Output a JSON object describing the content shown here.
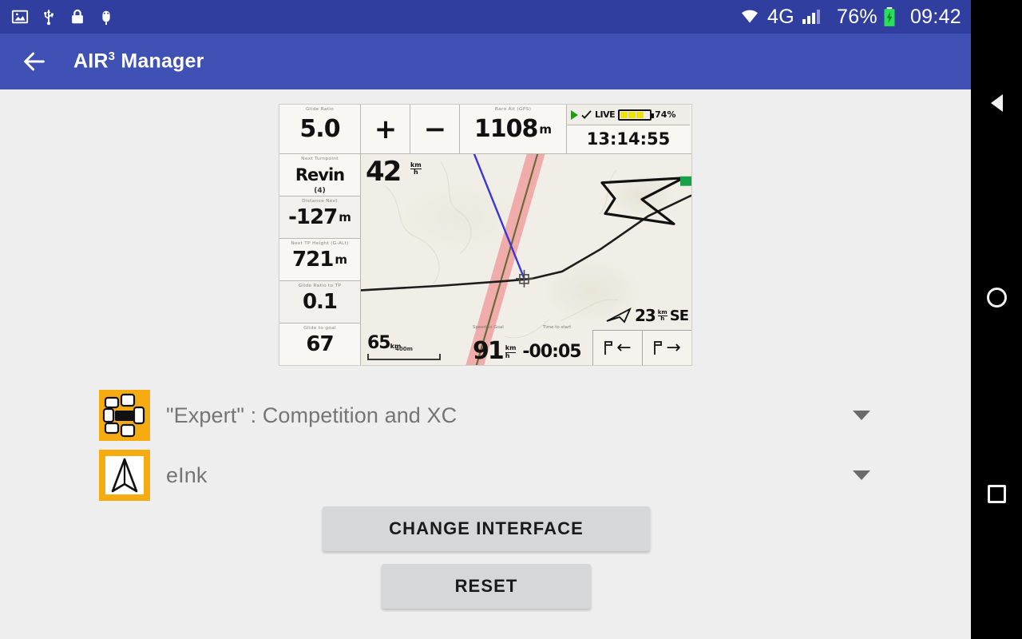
{
  "statusbar": {
    "left_icons": [
      "image-icon",
      "usb-icon",
      "lock-icon",
      "android-debug-icon"
    ],
    "network": "4G",
    "battery_percent": "76%",
    "time": "09:42",
    "bg_color": "#303f9f"
  },
  "appbar": {
    "back_label": "back-arrow",
    "title": "AIR",
    "title_sup": "3",
    "title_rest": " Manager",
    "bg_color": "#3f51b5"
  },
  "device_preview": {
    "top": {
      "glide_ratio": {
        "label": "Glide Ratio",
        "value": "5.0"
      },
      "plus": "+",
      "minus": "−",
      "altitude": {
        "label": "Baro Alt (GPS)",
        "value": "1108",
        "unit": "m"
      },
      "status": {
        "live": "LIVE",
        "battery_percent": "74%",
        "clock": "13:14:55"
      }
    },
    "left_column": [
      {
        "label": "Next Turnpoint",
        "value": "Revin",
        "sub": "(4)"
      },
      {
        "label": "Distance Next",
        "value": "-127",
        "unit": "m"
      },
      {
        "label": "Next TP Height (G-ALt)",
        "value": "721",
        "unit": "m"
      },
      {
        "label": "Glide Ratio to TP",
        "value": "0.1"
      },
      {
        "label": "Glide to goal",
        "value": "67"
      }
    ],
    "map": {
      "speed": "42",
      "speed_unit_top": "km",
      "speed_unit_bottom": "h",
      "scale_value": "65",
      "scale_unit": "km",
      "scale_bar_label": "400m",
      "ground_speed_label": "Speed to Goal",
      "ground_speed": "91",
      "ground_speed_unit_top": "km",
      "ground_speed_unit_bottom": "h",
      "time_label": "Time to start",
      "time_value": "-00:05",
      "wind_speed": "23",
      "wind_unit_top": "km",
      "wind_unit_bottom": "h",
      "wind_direction": "SE",
      "btn_prev": "←",
      "btn_next": "→"
    }
  },
  "selectors": [
    {
      "icon": "interface-layout-icon",
      "label": "\"Expert\" : Competition and XC",
      "caret": "chevron-down-icon"
    },
    {
      "icon": "elnk-navigation-icon",
      "label": "eInk",
      "caret": "chevron-down-icon"
    }
  ],
  "buttons": {
    "change_interface": "CHANGE INTERFACE",
    "reset": "RESET"
  },
  "navbar": {
    "back": "back-triangle-icon",
    "home": "home-circle-icon",
    "recents": "recents-square-icon"
  },
  "colors": {
    "accent_orange": "#f6ab11",
    "page_bg": "#eeeeee",
    "button_bg": "#d6d7d9",
    "label_grey": "#757575"
  }
}
